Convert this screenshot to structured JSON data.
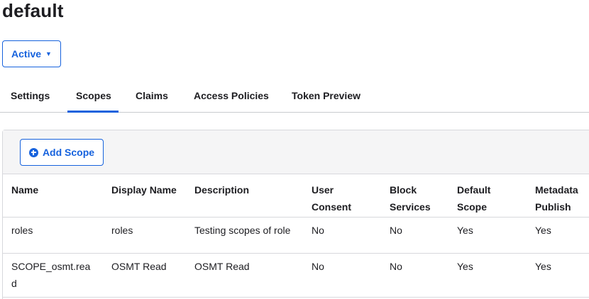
{
  "page": {
    "title": "default"
  },
  "status": {
    "label": "Active",
    "caret": "▼"
  },
  "tabs": [
    {
      "label": "Settings"
    },
    {
      "label": "Scopes",
      "active": true
    },
    {
      "label": "Claims"
    },
    {
      "label": "Access Policies"
    },
    {
      "label": "Token Preview"
    }
  ],
  "toolbar": {
    "add_label": "Add Scope",
    "add_icon": "plus-circle-icon"
  },
  "table": {
    "columns": [
      {
        "line1": "Name",
        "line2": ""
      },
      {
        "line1": "Display Name",
        "line2": ""
      },
      {
        "line1": "Description",
        "line2": ""
      },
      {
        "line1": "User",
        "line2": "Consent"
      },
      {
        "line1": "Block",
        "line2": "Services"
      },
      {
        "line1": "Default",
        "line2": "Scope"
      },
      {
        "line1": "Metadata",
        "line2": "Publish"
      }
    ],
    "rows": [
      {
        "cells": [
          {
            "line1": "roles",
            "line2": ""
          },
          {
            "line1": "roles",
            "line2": ""
          },
          {
            "line1": "Testing scopes of role",
            "line2": ""
          },
          {
            "line1": "No",
            "line2": ""
          },
          {
            "line1": "No",
            "line2": ""
          },
          {
            "line1": "Yes",
            "line2": ""
          },
          {
            "line1": "Yes",
            "line2": ""
          }
        ]
      },
      {
        "cells": [
          {
            "line1": "SCOPE_osmt.rea",
            "line2": "d"
          },
          {
            "line1": "OSMT Read",
            "line2": ""
          },
          {
            "line1": "OSMT Read",
            "line2": ""
          },
          {
            "line1": "No",
            "line2": ""
          },
          {
            "line1": "No",
            "line2": ""
          },
          {
            "line1": "Yes",
            "line2": ""
          },
          {
            "line1": "Yes",
            "line2": ""
          }
        ]
      }
    ]
  },
  "colors": {
    "accent": "#1662dd",
    "text": "#1d1d21",
    "border": "#d7d8dc",
    "toolbar_bg": "#f5f5f6"
  }
}
